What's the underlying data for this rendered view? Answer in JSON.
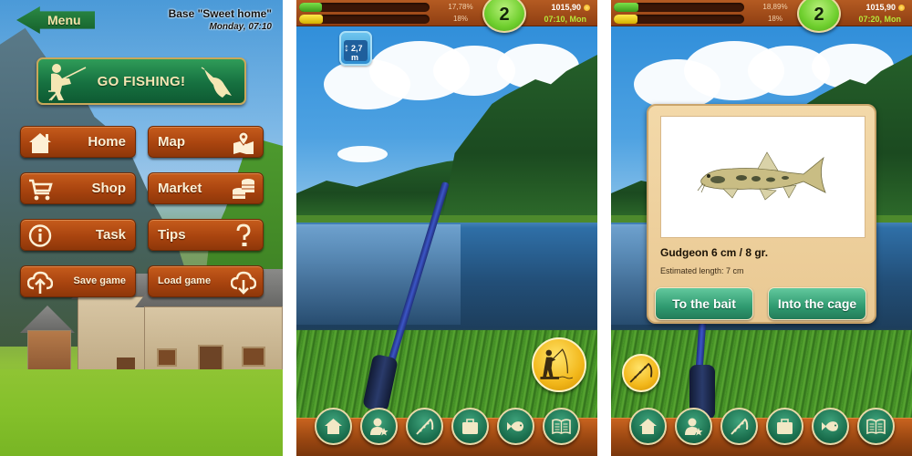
{
  "base_screen": {
    "back_button": {
      "label": "Menu",
      "icon": "arrow-left-icon"
    },
    "location_name": "Base \"Sweet home\"",
    "datetime": "Monday, 07:10",
    "go_fishing": {
      "label": "GO FISHING!",
      "icon_left": "fisherman-icon",
      "icon_right": "fish-icon"
    },
    "menu": [
      {
        "label": "Home",
        "icon": "house-icon",
        "column": "left"
      },
      {
        "label": "Map",
        "icon": "map-pin-icon",
        "column": "right"
      },
      {
        "label": "Shop",
        "icon": "cart-icon",
        "column": "left"
      },
      {
        "label": "Market",
        "icon": "coins-icon",
        "column": "right"
      },
      {
        "label": "Task",
        "icon": "info-icon",
        "column": "left"
      },
      {
        "label": "Tips",
        "icon": "question-icon",
        "column": "right"
      },
      {
        "label": "Save game",
        "icon": "cloud-upload-icon",
        "column": "left"
      },
      {
        "label": "Load game",
        "icon": "cloud-download-icon",
        "column": "right"
      }
    ]
  },
  "fishing_screen": {
    "hud": {
      "xp_percent_label": "17,78%",
      "xp_fraction": 0.1778,
      "energy_percent_label": "18%",
      "energy_fraction": 0.18,
      "level": "2",
      "money": "1015,90",
      "clock": "07:10, Mon"
    },
    "depth": "2,7 m",
    "action_button_icon": "fisherman-casting-icon"
  },
  "catch_screen": {
    "hud": {
      "xp_percent_label": "18,89%",
      "xp_fraction": 0.1889,
      "energy_percent_label": "18%",
      "energy_fraction": 0.18,
      "level": "2",
      "money": "1015,90",
      "clock": "07:20, Mon"
    },
    "dialog": {
      "fish_title": "Gudgeon 6 cm / 8 gr.",
      "estimate": "Estimated length: 7 cm",
      "bait_button": "To the bait",
      "cage_button": "Into the cage"
    },
    "action_button_icon": "fishing-rod-icon"
  },
  "bottom_nav": [
    {
      "icon": "house-icon",
      "name": "home"
    },
    {
      "icon": "profile-star-icon",
      "name": "profile"
    },
    {
      "icon": "fishing-rod-icon",
      "name": "tackle"
    },
    {
      "icon": "briefcase-icon",
      "name": "inventory"
    },
    {
      "icon": "fish-icon",
      "name": "catch"
    },
    {
      "icon": "book-icon",
      "name": "journal"
    }
  ],
  "colors": {
    "wood": "#a9440f",
    "green_button": "#167040",
    "level_green": "#6fcf2e",
    "clock_green": "#b7e83a",
    "gold": "#f2b71a",
    "dialog_bg": "#f3d9a9",
    "dialog_button": "#2f9a70"
  }
}
